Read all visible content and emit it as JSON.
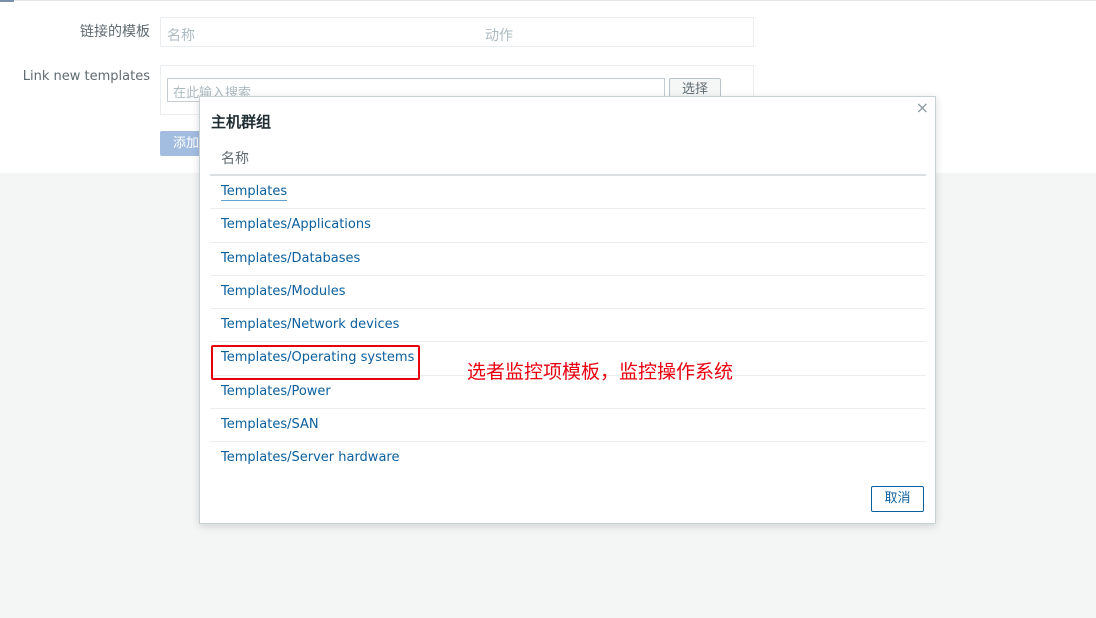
{
  "form": {
    "linked_templates_label": "链接的模板",
    "linked_col_name": "名称",
    "linked_col_action": "动作",
    "link_new_label": "Link new templates",
    "search_placeholder": "在此输入搜索",
    "select_button": "选择",
    "add_button": "添加"
  },
  "dialog": {
    "title": "主机群组",
    "close_icon": "×",
    "column_header": "名称",
    "items": [
      {
        "label": "Templates"
      },
      {
        "label": "Templates/Applications"
      },
      {
        "label": "Templates/Databases"
      },
      {
        "label": "Templates/Modules"
      },
      {
        "label": "Templates/Network devices"
      },
      {
        "label": "Templates/Operating systems"
      },
      {
        "label": "Templates/Power"
      },
      {
        "label": "Templates/SAN"
      },
      {
        "label": "Templates/Server hardware"
      }
    ],
    "annotation": "选者监控项模板，监控操作系统",
    "cancel_button": "取消"
  },
  "colors": {
    "link": "#0b5f9d",
    "highlight": "#e8000f",
    "add_button": "#a3bde1"
  }
}
